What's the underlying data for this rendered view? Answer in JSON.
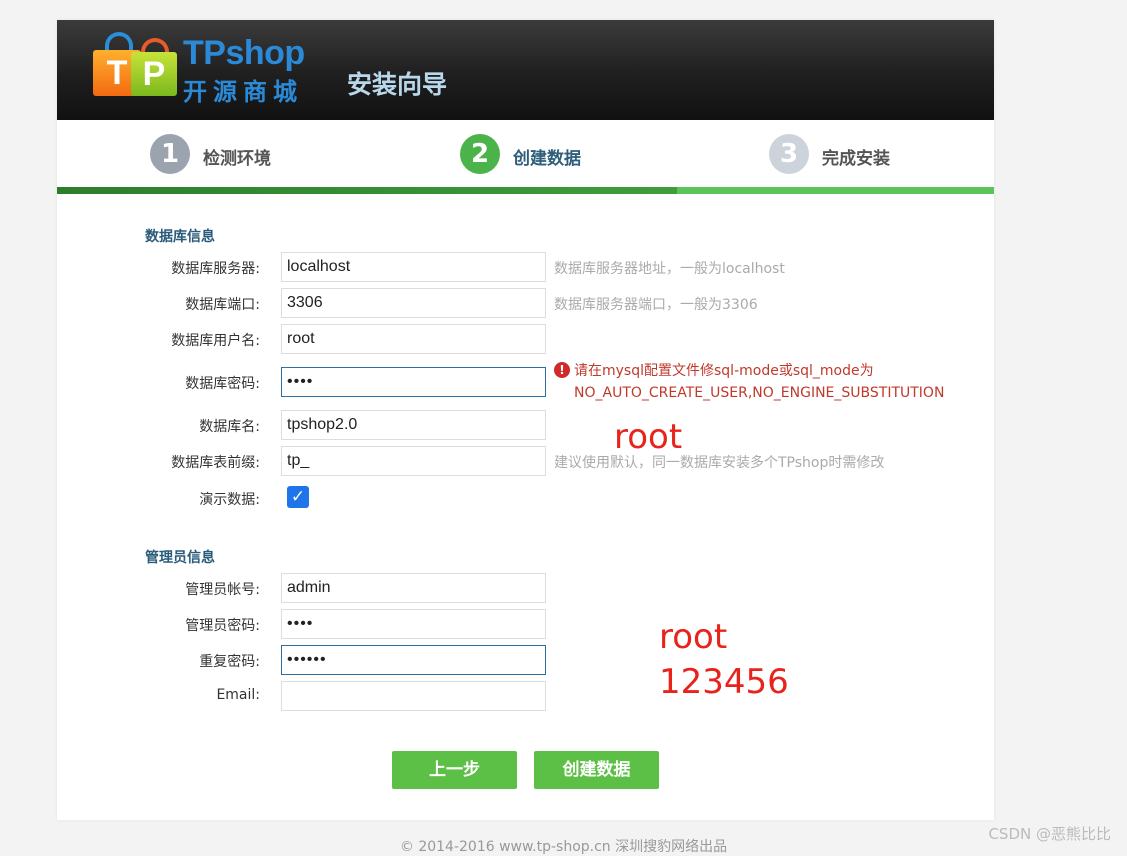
{
  "header": {
    "brand": "TPshop",
    "brand_sub": "开源商城",
    "logo_t": "T",
    "logo_p": "P",
    "wizard_title": "安装向导"
  },
  "steps": [
    {
      "num": "1",
      "label": "检测环境",
      "state": "done"
    },
    {
      "num": "2",
      "label": "创建数据",
      "state": "active"
    },
    {
      "num": "3",
      "label": "完成安装",
      "state": "pending"
    }
  ],
  "db": {
    "section_title": "数据库信息",
    "server_label": "数据库服务器:",
    "server_value": "localhost",
    "server_hint": "数据库服务器地址，一般为localhost",
    "port_label": "数据库端口:",
    "port_value": "3306",
    "port_hint": "数据库服务器端口，一般为3306",
    "user_label": "数据库用户名:",
    "user_value": "root",
    "password_label": "数据库密码:",
    "password_value": "••••",
    "password_error": "请在mysql配置文件修sql-mode或sql_mode为NO_AUTO_CREATE_USER,NO_ENGINE_SUBSTITUTION",
    "name_label": "数据库名:",
    "name_value": "tpshop2.0",
    "prefix_label": "数据库表前缀:",
    "prefix_value": "tp_",
    "prefix_hint": "建议使用默认，同一数据库安装多个TPshop时需修改",
    "demo_label": "演示数据:",
    "demo_checked": true
  },
  "admin": {
    "section_title": "管理员信息",
    "account_label": "管理员帐号:",
    "account_value": "admin",
    "password_label": "管理员密码:",
    "password_value": "••••",
    "repeat_label": "重复密码:",
    "repeat_value": "••••••",
    "email_label": "Email:",
    "email_value": ""
  },
  "buttons": {
    "prev": "上一步",
    "create": "创建数据"
  },
  "annotations": {
    "db_password": "root",
    "admin_line1": "root",
    "admin_line2": "123456"
  },
  "footer": "© 2014-2016 www.tp-shop.cn 深圳搜豹网络出品",
  "watermark": "CSDN @恶熊比比",
  "colors": {
    "accent_green": "#5cc046",
    "step_active": "#4cb34a",
    "error_red": "#c0392b",
    "annotation_red": "#e8231c"
  }
}
